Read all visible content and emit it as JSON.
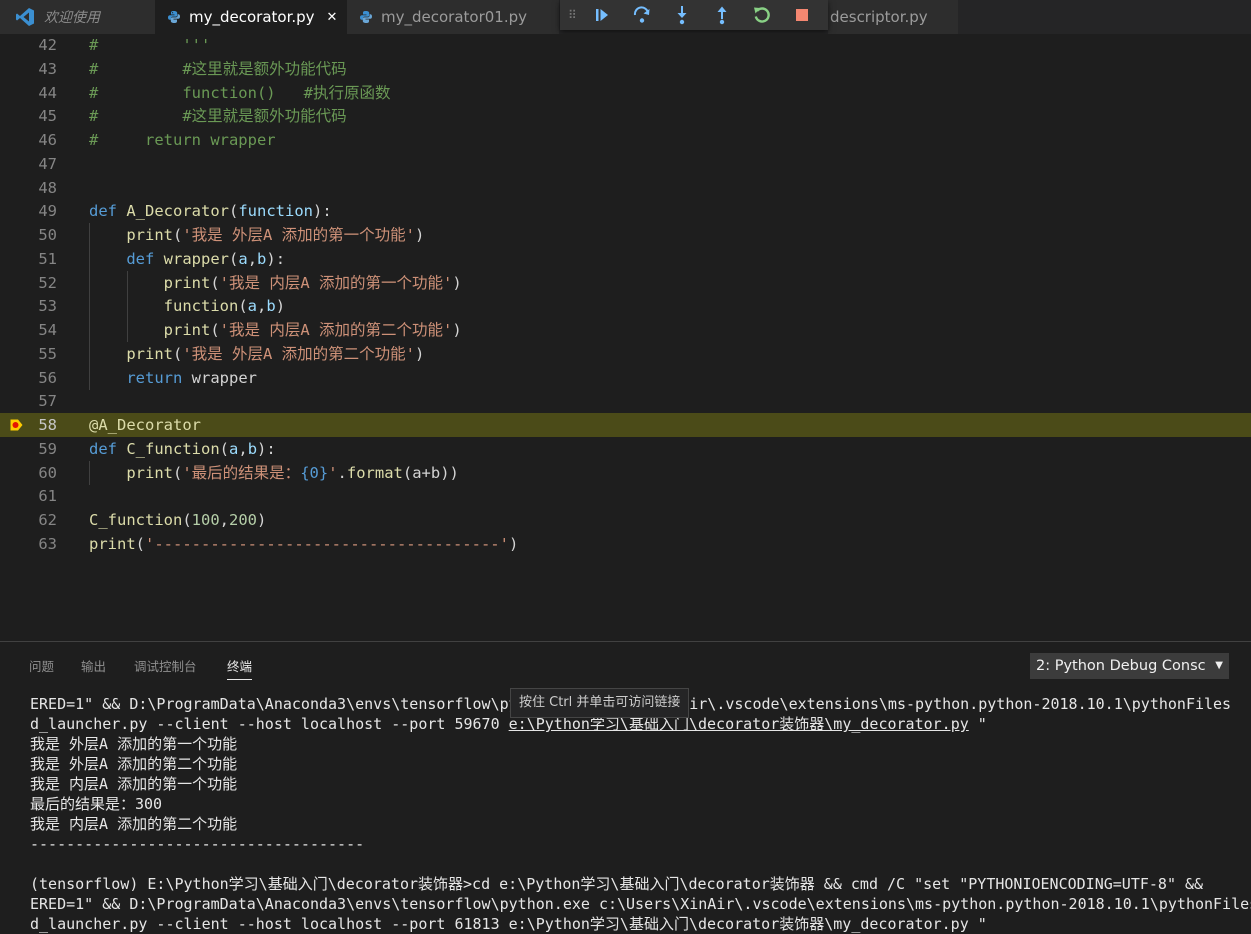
{
  "tabs": {
    "welcome": "欢迎使用",
    "items": [
      {
        "label": "my_decorator.py",
        "close": "✕"
      },
      {
        "label": "my_decorator01.py"
      },
      {
        "label": "descriptor.py"
      }
    ]
  },
  "editor": {
    "lines": [
      {
        "n": "42",
        "tokens": [
          {
            "t": "#         '''",
            "c": "c"
          }
        ]
      },
      {
        "n": "43",
        "tokens": [
          {
            "t": "#         #这里就是额外功能代码",
            "c": "c"
          }
        ]
      },
      {
        "n": "44",
        "tokens": [
          {
            "t": "#         function()   #执行原函数",
            "c": "c"
          }
        ]
      },
      {
        "n": "45",
        "tokens": [
          {
            "t": "#         #这里就是额外功能代码",
            "c": "c"
          }
        ]
      },
      {
        "n": "46",
        "tokens": [
          {
            "t": "#     return wrapper",
            "c": "c"
          }
        ]
      },
      {
        "n": "47",
        "tokens": []
      },
      {
        "n": "48",
        "tokens": []
      },
      {
        "n": "49",
        "tokens": [
          {
            "t": "def",
            "c": "k"
          },
          {
            "t": " ",
            "c": "t"
          },
          {
            "t": "A_Decorator",
            "c": "f"
          },
          {
            "t": "(",
            "c": "t"
          },
          {
            "t": "function",
            "c": "p"
          },
          {
            "t": "):",
            "c": "t"
          }
        ]
      },
      {
        "n": "50",
        "indent": 1,
        "tokens": [
          {
            "t": "    ",
            "c": "t"
          },
          {
            "t": "print",
            "c": "f"
          },
          {
            "t": "(",
            "c": "t"
          },
          {
            "t": "'我是 外层A 添加的第一个功能'",
            "c": "s"
          },
          {
            "t": ")",
            "c": "t"
          }
        ]
      },
      {
        "n": "51",
        "indent": 1,
        "tokens": [
          {
            "t": "    ",
            "c": "t"
          },
          {
            "t": "def",
            "c": "k"
          },
          {
            "t": " ",
            "c": "t"
          },
          {
            "t": "wrapper",
            "c": "f"
          },
          {
            "t": "(",
            "c": "t"
          },
          {
            "t": "a",
            "c": "p"
          },
          {
            "t": ",",
            "c": "t"
          },
          {
            "t": "b",
            "c": "p"
          },
          {
            "t": "):",
            "c": "t"
          }
        ]
      },
      {
        "n": "52",
        "indent": 2,
        "tokens": [
          {
            "t": "        ",
            "c": "t"
          },
          {
            "t": "print",
            "c": "f"
          },
          {
            "t": "(",
            "c": "t"
          },
          {
            "t": "'我是 内层A 添加的第一个功能'",
            "c": "s"
          },
          {
            "t": ")",
            "c": "t"
          }
        ]
      },
      {
        "n": "53",
        "indent": 2,
        "tokens": [
          {
            "t": "        ",
            "c": "t"
          },
          {
            "t": "function",
            "c": "f"
          },
          {
            "t": "(",
            "c": "t"
          },
          {
            "t": "a",
            "c": "p"
          },
          {
            "t": ",",
            "c": "t"
          },
          {
            "t": "b",
            "c": "p"
          },
          {
            "t": ")",
            "c": "t"
          }
        ]
      },
      {
        "n": "54",
        "indent": 2,
        "tokens": [
          {
            "t": "        ",
            "c": "t"
          },
          {
            "t": "print",
            "c": "f"
          },
          {
            "t": "(",
            "c": "t"
          },
          {
            "t": "'我是 内层A 添加的第二个功能'",
            "c": "s"
          },
          {
            "t": ")",
            "c": "t"
          }
        ]
      },
      {
        "n": "55",
        "indent": 1,
        "tokens": [
          {
            "t": "    ",
            "c": "t"
          },
          {
            "t": "print",
            "c": "f"
          },
          {
            "t": "(",
            "c": "t"
          },
          {
            "t": "'我是 外层A 添加的第二个功能'",
            "c": "s"
          },
          {
            "t": ")",
            "c": "t"
          }
        ]
      },
      {
        "n": "56",
        "indent": 1,
        "tokens": [
          {
            "t": "    ",
            "c": "t"
          },
          {
            "t": "return",
            "c": "k"
          },
          {
            "t": " wrapper",
            "c": "t"
          }
        ]
      },
      {
        "n": "57",
        "tokens": []
      },
      {
        "n": "58",
        "current": true,
        "tokens": [
          {
            "t": "@A_Decorator",
            "c": "f"
          }
        ]
      },
      {
        "n": "59",
        "tokens": [
          {
            "t": "def",
            "c": "k"
          },
          {
            "t": " ",
            "c": "t"
          },
          {
            "t": "C_function",
            "c": "f"
          },
          {
            "t": "(",
            "c": "t"
          },
          {
            "t": "a",
            "c": "p"
          },
          {
            "t": ",",
            "c": "t"
          },
          {
            "t": "b",
            "c": "p"
          },
          {
            "t": "):",
            "c": "t"
          }
        ]
      },
      {
        "n": "60",
        "indent": 1,
        "tokens": [
          {
            "t": "    ",
            "c": "t"
          },
          {
            "t": "print",
            "c": "f"
          },
          {
            "t": "(",
            "c": "t"
          },
          {
            "t": "'最后的结果是：",
            "c": "s"
          },
          {
            "t": "{0}",
            "c": "sc"
          },
          {
            "t": "'",
            "c": "s"
          },
          {
            "t": ".",
            "c": "t"
          },
          {
            "t": "format",
            "c": "f"
          },
          {
            "t": "(a+b))",
            "c": "t"
          }
        ]
      },
      {
        "n": "61",
        "tokens": []
      },
      {
        "n": "62",
        "tokens": [
          {
            "t": "C_function",
            "c": "f"
          },
          {
            "t": "(",
            "c": "t"
          },
          {
            "t": "100",
            "c": "n"
          },
          {
            "t": ",",
            "c": "t"
          },
          {
            "t": "200",
            "c": "n"
          },
          {
            "t": ")",
            "c": "t"
          }
        ]
      },
      {
        "n": "63",
        "tokens": [
          {
            "t": "print",
            "c": "f"
          },
          {
            "t": "(",
            "c": "t"
          },
          {
            "t": "'-------------------------------------'",
            "c": "s"
          },
          {
            "t": ")",
            "c": "t"
          }
        ]
      }
    ]
  },
  "panel": {
    "tabs": [
      "问题",
      "输出",
      "调试控制台",
      "终端"
    ],
    "terminal_select": "2: Python Debug Consc",
    "terminal_select_arrow": "▼",
    "lines": [
      {
        "text": "ERED=1\" && D:\\ProgramData\\Anaconda3\\envs\\tensorflow\\py                  Air\\.vscode\\extensions\\ms-python.python-2018.10.1\\pythonFiles"
      },
      {
        "pre": "d_launcher.py --client --host localhost --port 59670 ",
        "link": "e:\\Python学习\\基础入门\\decorator装饰器\\my_decorator.py",
        "post": " \""
      },
      {
        "text": "我是 外层A 添加的第一个功能"
      },
      {
        "text": "我是 外层A 添加的第二个功能"
      },
      {
        "text": "我是 内层A 添加的第一个功能"
      },
      {
        "text": "最后的结果是：300"
      },
      {
        "text": "我是 内层A 添加的第二个功能"
      },
      {
        "text": "-------------------------------------"
      },
      {
        "text": ""
      },
      {
        "text": "(tensorflow) E:\\Python学习\\基础入门\\decorator装饰器>cd e:\\Python学习\\基础入门\\decorator装饰器 && cmd /C \"set \"PYTHONIOENCODING=UTF-8\" &&"
      },
      {
        "text": "ERED=1\" && D:\\ProgramData\\Anaconda3\\envs\\tensorflow\\python.exe c:\\Users\\XinAir\\.vscode\\extensions\\ms-python.python-2018.10.1\\pythonFiles"
      },
      {
        "text": "d_launcher.py --client --host localhost --port 61813 e:\\Python学习\\基础入门\\decorator装饰器\\my_decorator.py \""
      }
    ],
    "tooltip": "按住 Ctrl 并单击可访问链接"
  },
  "colors": {
    "keyword": "#569cd6",
    "function": "#dcdcaa",
    "string": "#ce9178",
    "comment": "#6a9955",
    "number": "#b5cea8",
    "current_line": "#4b4b18",
    "python_icon": "#3b8fd1",
    "debug_icon": "#75beff",
    "restart_icon": "#89d185",
    "stop_icon": "#f48771"
  }
}
